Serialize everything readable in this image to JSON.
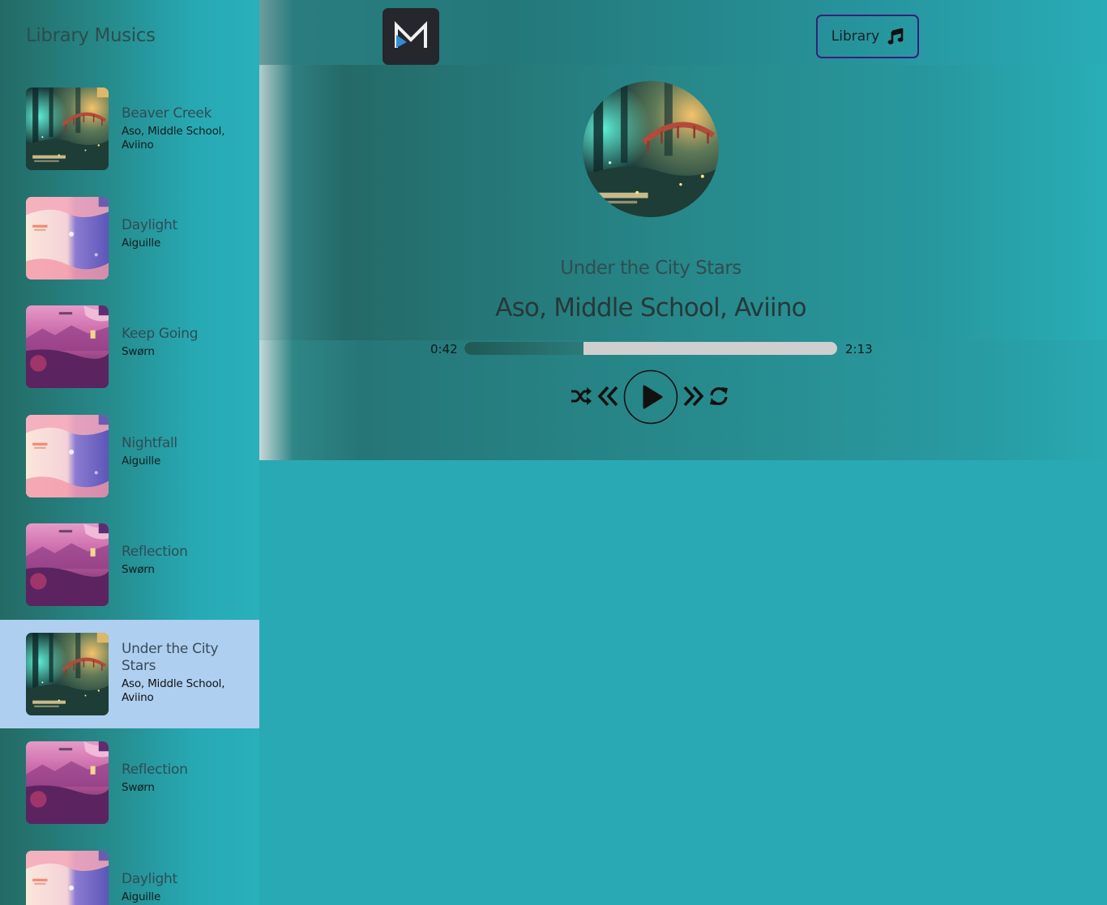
{
  "sidebar": {
    "title": "Library Musics",
    "items": [
      {
        "title": "Beaver Creek",
        "artist": "Aso, Middle School, Aviino",
        "cover": "forest"
      },
      {
        "title": "Daylight",
        "artist": "Aiguille",
        "cover": "daylight"
      },
      {
        "title": "Keep Going",
        "artist": "Swørn",
        "cover": "pink"
      },
      {
        "title": "Nightfall",
        "artist": "Aiguille",
        "cover": "daylight"
      },
      {
        "title": "Reflection",
        "artist": "Swørn",
        "cover": "pink"
      },
      {
        "title": "Under the City Stars",
        "artist": "Aso, Middle School, Aviino",
        "cover": "forest",
        "active": true
      },
      {
        "title": "Reflection",
        "artist": "Swørn",
        "cover": "pink"
      },
      {
        "title": "Daylight",
        "artist": "Aiguille",
        "cover": "daylight"
      }
    ]
  },
  "header": {
    "logo_icon": "m-logo-icon",
    "library_label": "Library",
    "library_icon": "music-note-icon"
  },
  "player": {
    "title": "Under the City Stars",
    "artist": "Aso, Middle School, Aviino",
    "current_time": "0:42",
    "total_time": "2:13",
    "progress": 0.32,
    "controls": [
      "shuffle-icon",
      "previous-icon",
      "play-icon",
      "next-icon",
      "repeat-icon"
    ]
  },
  "colors": {
    "active_item": "#aecff0",
    "library_border": "#3b1d7c",
    "logo_bg": "#25272c",
    "track": "#cfcfcf",
    "track_fill": "#1f5953"
  }
}
